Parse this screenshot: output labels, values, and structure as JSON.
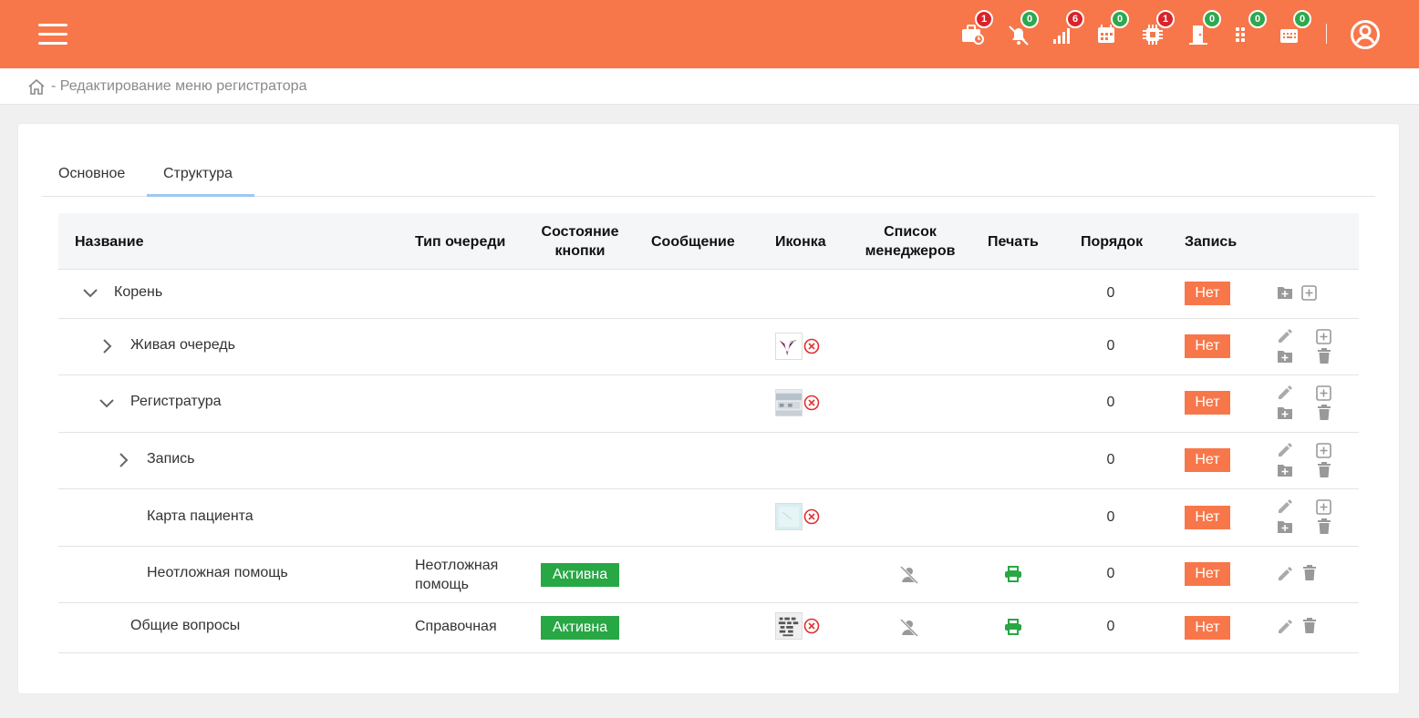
{
  "topbar": {
    "notifications": [
      {
        "icon": "briefcase-clock-icon",
        "count": "1",
        "color": "red"
      },
      {
        "icon": "bell-off-icon",
        "count": "0",
        "color": "green"
      },
      {
        "icon": "signal-bars-icon",
        "count": "6",
        "color": "red"
      },
      {
        "icon": "calendar-icon",
        "count": "0",
        "color": "green"
      },
      {
        "icon": "chip-icon",
        "count": "1",
        "color": "red"
      },
      {
        "icon": "door-icon",
        "count": "0",
        "color": "green"
      },
      {
        "icon": "grid-icon",
        "count": "0",
        "color": "green"
      },
      {
        "icon": "keyboard-icon",
        "count": "0",
        "color": "green"
      }
    ],
    "accent": "#f7774a"
  },
  "breadcrumb": {
    "text": "- Редактирование меню регистратора"
  },
  "tabs": [
    {
      "label": "Основное"
    },
    {
      "label": "Структура",
      "active": true
    }
  ],
  "table": {
    "headers": {
      "name": "Название",
      "queue_type": "Тип очереди",
      "button_state_1": "Состояние",
      "button_state_2": "кнопки",
      "message": "Сообщение",
      "icon": "Иконка",
      "managers_1": "Список",
      "managers_2": "менеджеров",
      "print": "Печать",
      "order": "Порядок",
      "record": "Запись"
    },
    "rows": [
      {
        "name": "Корень",
        "order": "0",
        "record": "Нет"
      },
      {
        "name": "Живая очередь",
        "order": "0",
        "record": "Нет"
      },
      {
        "name": "Регистратура",
        "order": "0",
        "record": "Нет"
      },
      {
        "name": "Запись",
        "order": "0",
        "record": "Нет"
      },
      {
        "name": "Карта пациента",
        "order": "0",
        "record": "Нет"
      },
      {
        "name": "Неотложная помощь",
        "queue_type_1": "Неотложная",
        "queue_type_2": "помощь",
        "state": "Активна",
        "order": "0",
        "record": "Нет"
      },
      {
        "name": "Общие вопросы",
        "queue_type": "Справочная",
        "state": "Активна",
        "order": "0",
        "record": "Нет"
      }
    ]
  }
}
